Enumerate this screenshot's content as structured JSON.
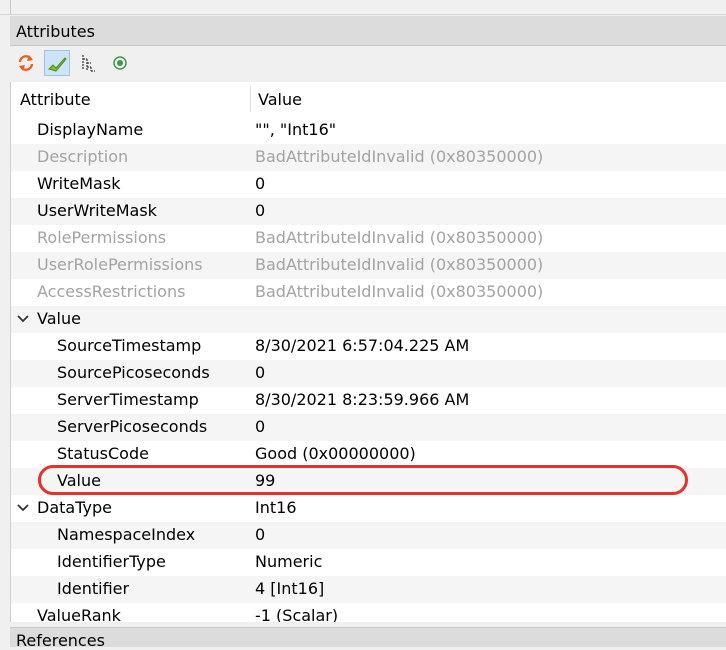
{
  "panel_title": "Attributes",
  "toolbar": {
    "refresh_icon": "refresh-icon",
    "check_icon": "checkmark-icon",
    "tree_icon": "tree-icon",
    "radio_icon": "radio-icon"
  },
  "columns": {
    "attribute": "Attribute",
    "value": "Value"
  },
  "rows": [
    {
      "name": "DisplayName",
      "value": "\"\", \"Int16\""
    },
    {
      "name": "Description",
      "value": "BadAttributeIdInvalid (0x80350000)"
    },
    {
      "name": "WriteMask",
      "value": "0"
    },
    {
      "name": "UserWriteMask",
      "value": "0"
    },
    {
      "name": "RolePermissions",
      "value": "BadAttributeIdInvalid (0x80350000)"
    },
    {
      "name": "UserRolePermissions",
      "value": "BadAttributeIdInvalid (0x80350000)"
    },
    {
      "name": "AccessRestrictions",
      "value": "BadAttributeIdInvalid (0x80350000)"
    },
    {
      "name": "Value",
      "value": ""
    },
    {
      "name": "SourceTimestamp",
      "value": "8/30/2021 6:57:04.225 AM"
    },
    {
      "name": "SourcePicoseconds",
      "value": "0"
    },
    {
      "name": "ServerTimestamp",
      "value": "8/30/2021 8:23:59.966 AM"
    },
    {
      "name": "ServerPicoseconds",
      "value": "0"
    },
    {
      "name": "StatusCode",
      "value": "Good (0x00000000)"
    },
    {
      "name": "Value",
      "value": "99"
    },
    {
      "name": "DataType",
      "value": "Int16"
    },
    {
      "name": "NamespaceIndex",
      "value": "0"
    },
    {
      "name": "IdentifierType",
      "value": "Numeric"
    },
    {
      "name": "Identifier",
      "value": "4 [Int16]"
    },
    {
      "name": "ValueRank",
      "value": "-1 (Scalar)"
    }
  ],
  "references_title": "References",
  "colors": {
    "highlight": "#e8312a",
    "disabled_text": "#a3a3a3"
  }
}
